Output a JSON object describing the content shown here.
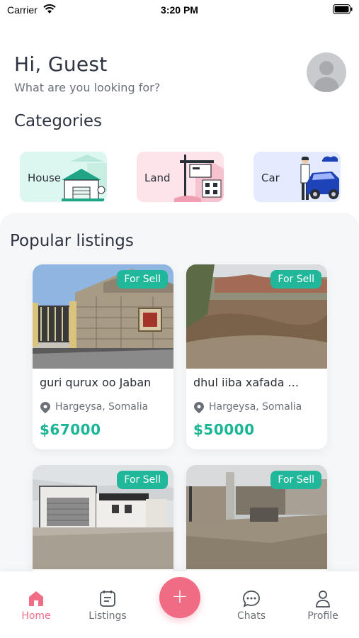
{
  "status_bar": {
    "carrier": "Carrier",
    "time": "3:20 PM"
  },
  "header": {
    "greeting": "Hi, Guest",
    "subtitle": "What are you looking for?"
  },
  "categories": {
    "title": "Categories",
    "items": [
      {
        "label": "House",
        "icon": "house-icon"
      },
      {
        "label": "Land",
        "icon": "land-sign-icon"
      },
      {
        "label": "Car",
        "icon": "car-icon"
      }
    ]
  },
  "popular": {
    "title": "Popular listings",
    "listings": [
      {
        "badge": "For Sell",
        "title": "guri qurux oo Jaban",
        "location": "Hargeysa, Somalia",
        "price": "$67000"
      },
      {
        "badge": "For Sell",
        "title": "dhul iiba xafada ...",
        "location": "Hargeysa, Somalia",
        "price": "$50000"
      },
      {
        "badge": "For Sell"
      },
      {
        "badge": "For Sell"
      }
    ]
  },
  "tabbar": {
    "items": [
      {
        "label": "Home",
        "icon": "home-icon",
        "active": true
      },
      {
        "label": "Listings",
        "icon": "calendar-list-icon"
      },
      {
        "label": "Chats",
        "icon": "chat-bubble-icon"
      },
      {
        "label": "Profile",
        "icon": "person-icon"
      }
    ],
    "fab_symbol": "+"
  },
  "colors": {
    "accent_green": "#1ab595",
    "badge_green": "#20b79a",
    "accent_pink": "#f06b84"
  }
}
